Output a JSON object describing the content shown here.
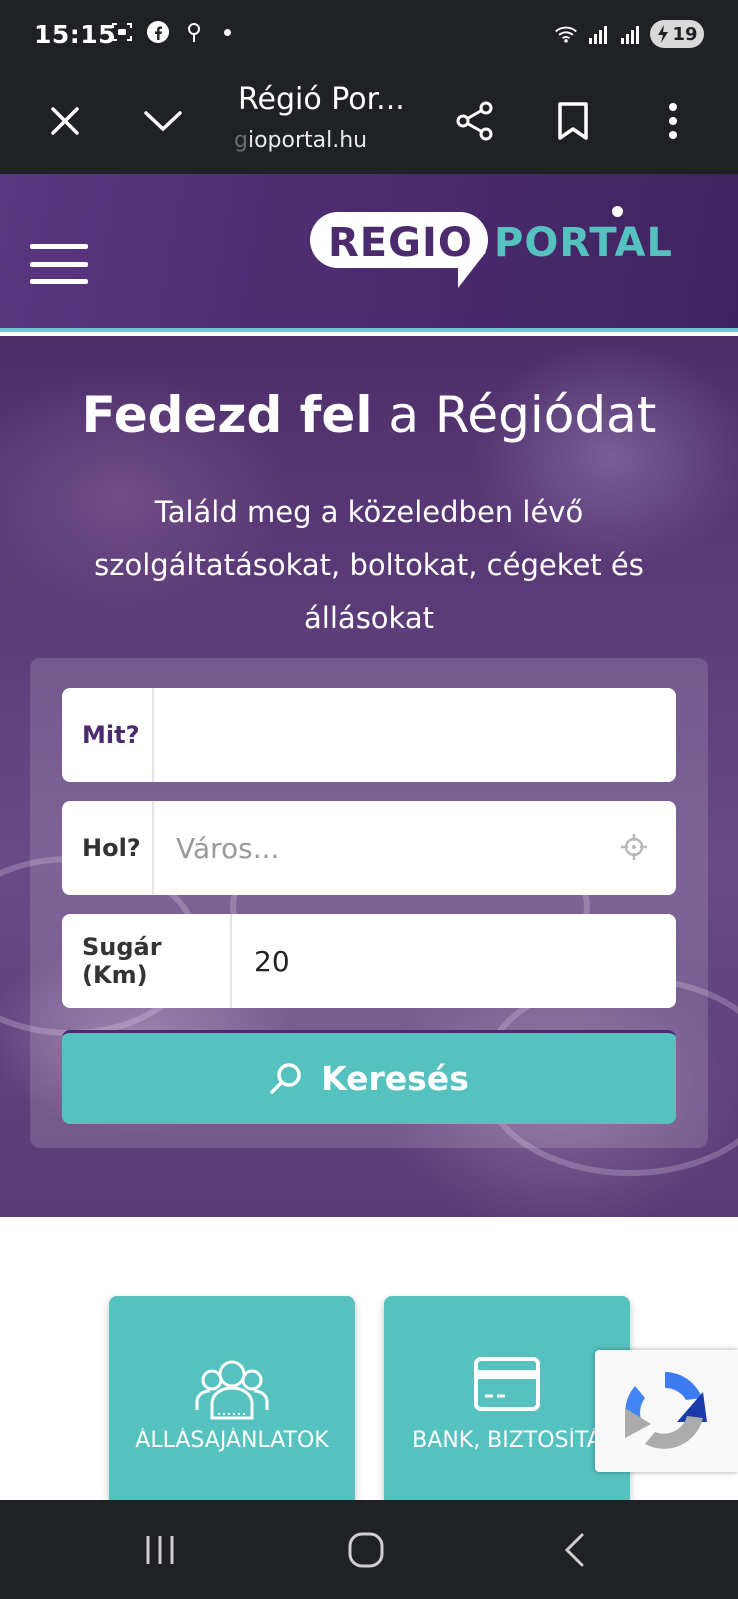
{
  "status_bar": {
    "time": "15:15",
    "battery": "19",
    "icons": [
      "screenshot-icon",
      "facebook-icon",
      "location-pin-icon",
      "wifi-icon",
      "signal-icon",
      "signal-icon-2",
      "battery-icon"
    ]
  },
  "browser": {
    "title": "Régió Por...",
    "url_faded": "g",
    "url": "ioportal.hu"
  },
  "header": {
    "logo_left": "REGIO",
    "logo_right": "PORTAL"
  },
  "hero": {
    "title_bold": "Fedezd fel",
    "title_rest": " a Régiódat",
    "subtitle": "Találd meg a közeledben lévő szolgáltatásokat, boltokat, cégeket és állásokat"
  },
  "search": {
    "what_label": "Mit?",
    "what_value": "",
    "where_label": "Hol?",
    "where_placeholder": "Város...",
    "radius_label": "Sugár (Km)",
    "radius_value": "20",
    "button_label": "Keresés"
  },
  "categories": [
    {
      "label": "ÁLLÁSAJÁNLATOK",
      "icon": "users-icon"
    },
    {
      "label": "BANK, BIZTOSÍTÁ",
      "icon": "credit-card-icon"
    }
  ],
  "colors": {
    "bar": "#202124",
    "brand_purple": "#4b2a6e",
    "brand_teal": "#55c2bf"
  }
}
